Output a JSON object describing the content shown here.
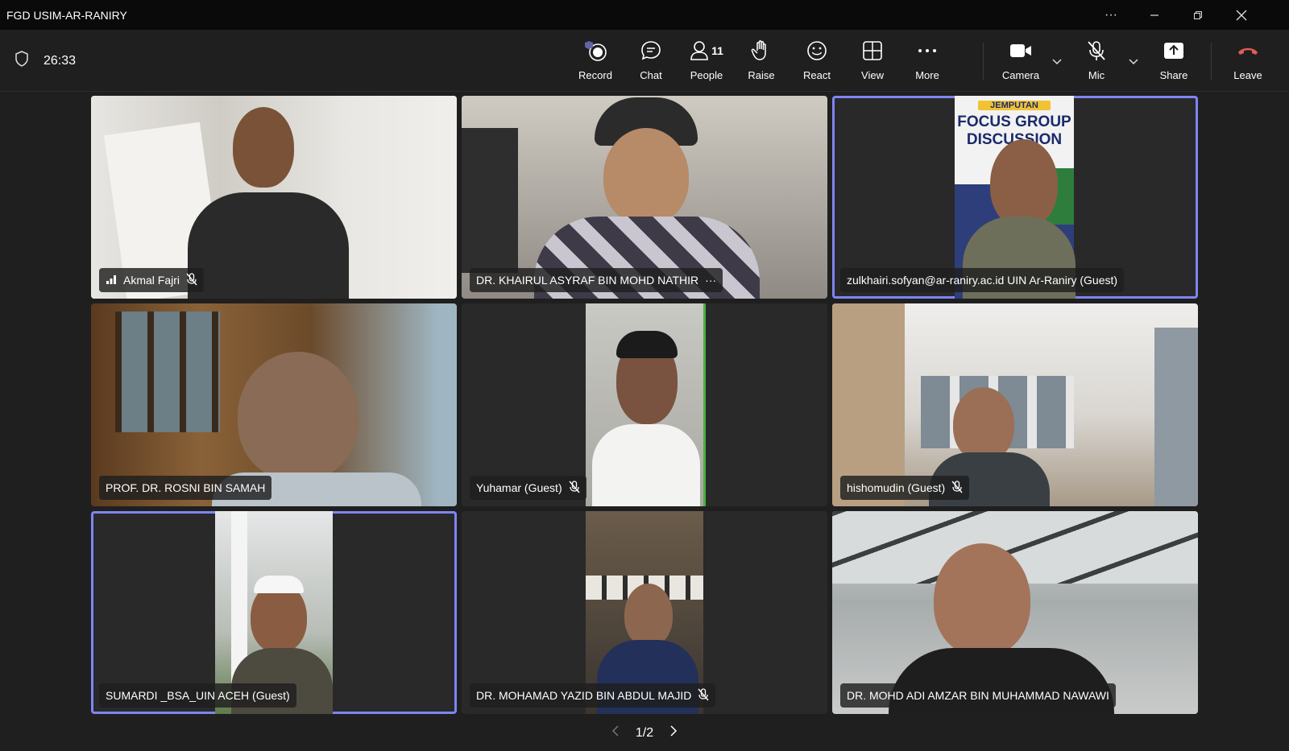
{
  "window": {
    "title": "FGD USIM-AR-RANIRY"
  },
  "meeting": {
    "timer": "26:33"
  },
  "toolbar": {
    "record": "Record",
    "chat": "Chat",
    "people": "People",
    "people_count": "11",
    "raise": "Raise",
    "react": "React",
    "view": "View",
    "more": "More",
    "camera": "Camera",
    "mic": "Mic",
    "share": "Share",
    "leave": "Leave"
  },
  "participants": [
    {
      "name": "Akmal Fajri",
      "muted": true,
      "signal": true
    },
    {
      "name": "DR. KHAIRUL ASYRAF BIN MOHD NATHIR",
      "more": "···"
    },
    {
      "name": "zulkhairi.sofyan@ar-raniry.ac.id UIN Ar-Raniry (Guest)",
      "active": true
    },
    {
      "name": "PROF. DR. ROSNI BIN SAMAH"
    },
    {
      "name": "Yuhamar (Guest)",
      "muted": true
    },
    {
      "name": "hishomudin (Guest)",
      "muted": true
    },
    {
      "name": "SUMARDI _BSA_UIN ACEH (Guest)",
      "active": true
    },
    {
      "name": "DR. MOHAMAD YAZID BIN ABDUL MAJID",
      "muted": true
    },
    {
      "name": "DR. MOHD ADI AMZAR BIN MUHAMMAD NAWAWI"
    }
  ],
  "banner": {
    "line1": "JEMPUTAN",
    "line2": "FOCUS GROUP",
    "line3": "DISCUSSION"
  },
  "pager": {
    "label": "1/2"
  },
  "colors": {
    "accent": "#7f85f5",
    "leave": "#e05b5b",
    "background": "#1f1f1f"
  }
}
